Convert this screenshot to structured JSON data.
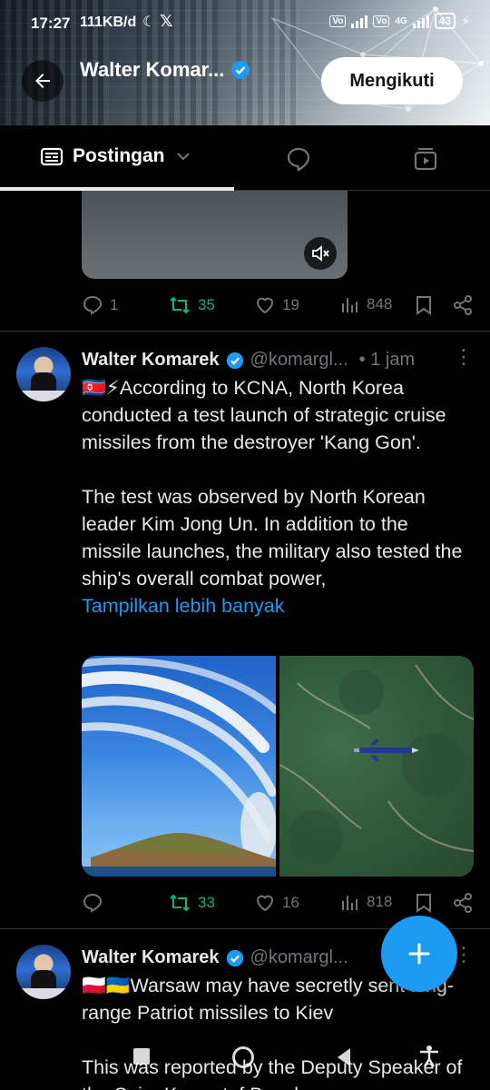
{
  "status_bar": {
    "time": "17:27",
    "speed": "111KB/d",
    "network_label": "4G",
    "battery": "43"
  },
  "header": {
    "profile_name": "Walter Komar...",
    "follow_label": "Mengikuti"
  },
  "tabs": {
    "posts_label": "Postingan"
  },
  "previous_tweet": {
    "replies": "1",
    "reposts": "35",
    "likes": "19",
    "views": "848"
  },
  "tweet1": {
    "name": "Walter Komarek",
    "handle": "@komargl...",
    "time": "• 1 jam",
    "text_line1": "🇰🇵⚡According to KCNA, North Korea conducted a test launch of strategic cruise missiles from the destroyer 'Kang Gon'.",
    "text_line2": "The test was observed by North Korean leader Kim Jong Un. In addition to the missile launches, the military also tested the ship's overall combat power,",
    "show_more": "Tampilkan lebih banyak",
    "replies": "",
    "reposts": "33",
    "likes": "16",
    "views": "818"
  },
  "tweet2": {
    "name": "Walter Komarek",
    "handle": "@komargl...",
    "text_line1": "🇵🇱🇺🇦Warsaw may have secretly sent long-range Patriot missiles to Kiev",
    "text_line2": "This was reported by the Deputy Speaker of the Sejm Krzysztof Bosak"
  },
  "colors": {
    "accent": "#1d9bf0",
    "repost_green": "#00ba7c",
    "muted_gray": "#71767b",
    "divider": "#2f3336"
  },
  "icons": {
    "back": "arrow-left-icon",
    "verified": "verified-badge-icon",
    "posts": "posts-icon",
    "chevron": "chevron-down-icon",
    "replies_tab": "chat-bubble-icon",
    "media_tab": "video-icon",
    "mute": "speaker-mute-icon",
    "reply": "reply-icon",
    "repost": "repost-icon",
    "like": "heart-icon",
    "views": "bar-chart-icon",
    "bookmark": "bookmark-icon",
    "share": "share-icon",
    "compose": "plus-icon"
  }
}
